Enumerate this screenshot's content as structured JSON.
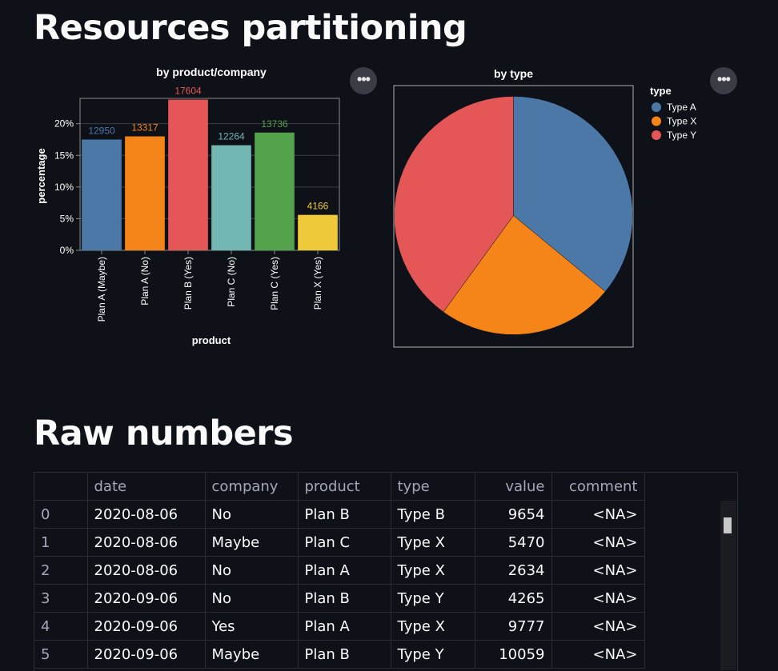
{
  "headings": {
    "main": "Resources partitioning",
    "raw": "Raw numbers"
  },
  "icons": {
    "menu": "more-horizontal-icon"
  },
  "colors": {
    "background": "#0e1117",
    "series": [
      "#4c78a8",
      "#f58518",
      "#e45756",
      "#72b7b2",
      "#54a24b",
      "#eeca3b"
    ]
  },
  "chart_data": [
    {
      "type": "bar",
      "title": "by product/company",
      "xlabel": "product",
      "ylabel": "percentage",
      "categories": [
        "Plan A (Maybe)",
        "Plan A (No)",
        "Plan B (Yes)",
        "Plan C (No)",
        "Plan C (Yes)",
        "Plan X (Yes)"
      ],
      "values": [
        17.5,
        18.0,
        23.8,
        16.6,
        18.6,
        5.6
      ],
      "data_labels": [
        "12950",
        "13317",
        "17604",
        "12264",
        "13736",
        "4166"
      ],
      "yticks": [
        "0%",
        "5%",
        "10%",
        "15%",
        "20%"
      ],
      "ylim": [
        0,
        24
      ],
      "grid": true
    },
    {
      "type": "pie",
      "title": "by type",
      "legend_title": "type",
      "legend_position": "top-right",
      "labels": [
        "Type A",
        "Type X",
        "Type Y"
      ],
      "values": [
        36,
        24,
        40
      ]
    }
  ],
  "table": {
    "columns": [
      "",
      "date",
      "company",
      "product",
      "type",
      "value",
      "comment"
    ],
    "rows": [
      [
        "0",
        "2020-08-06",
        "No",
        "Plan B",
        "Type B",
        "9654",
        "<NA>"
      ],
      [
        "1",
        "2020-08-06",
        "Maybe",
        "Plan C",
        "Type X",
        "5470",
        "<NA>"
      ],
      [
        "2",
        "2020-08-06",
        "No",
        "Plan A",
        "Type X",
        "2634",
        "<NA>"
      ],
      [
        "3",
        "2020-09-06",
        "No",
        "Plan B",
        "Type Y",
        "4265",
        "<NA>"
      ],
      [
        "4",
        "2020-09-06",
        "Yes",
        "Plan A",
        "Type X",
        "9777",
        "<NA>"
      ],
      [
        "5",
        "2020-09-06",
        "Maybe",
        "Plan B",
        "Type Y",
        "10059",
        "<NA>"
      ]
    ]
  }
}
